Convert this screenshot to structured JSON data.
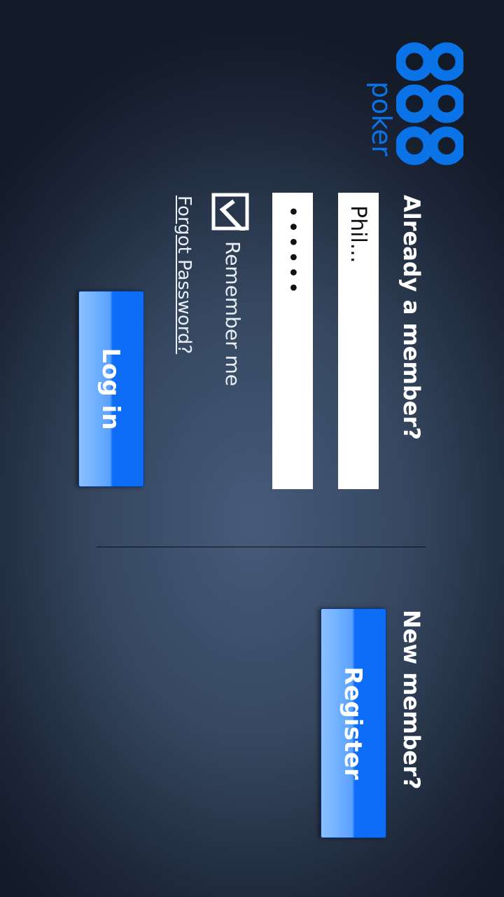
{
  "brand": {
    "logo_digits": "888",
    "poker_text": "poker",
    "logo_color": "#0a73e8"
  },
  "login": {
    "heading": "Already a member?",
    "username_value": "Phil...",
    "password_value": "••••••",
    "remember_label": "Remember me",
    "remember_checked": true,
    "forgot_password": "Forgot Password?",
    "login_button": "Log in"
  },
  "register": {
    "heading": "New member?",
    "register_button": "Register"
  },
  "icons": {
    "checkbox": "checkmark-icon"
  },
  "colors": {
    "button_blue": "#0e6df7",
    "text_white": "#ffffff"
  }
}
